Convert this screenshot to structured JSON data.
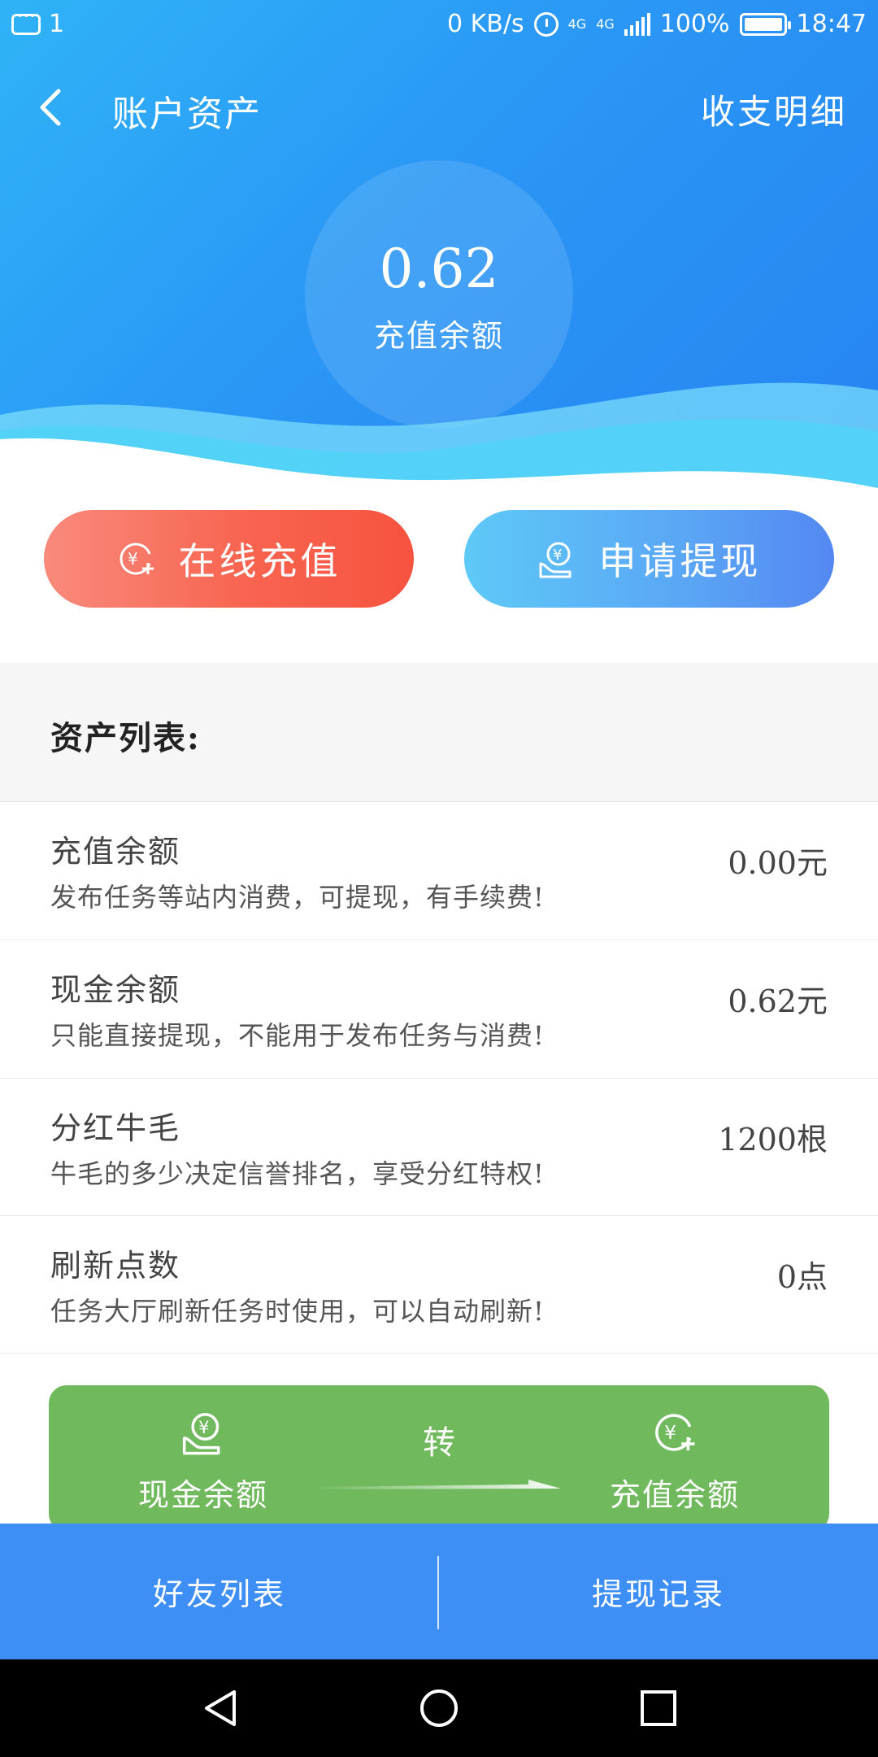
{
  "status_bar": {
    "notification_count": "1",
    "speed": "0 KB/s",
    "net_1": "4G",
    "net_2": "4G",
    "battery": "100%",
    "time": "18:47"
  },
  "nav": {
    "title": "账户资产",
    "detail_link": "收支明细"
  },
  "balance": {
    "value": "0.62",
    "label": "充值余额"
  },
  "actions": {
    "recharge_label": "在线充值",
    "withdraw_label": "申请提现"
  },
  "assets": {
    "section_title": "资产列表:",
    "items": [
      {
        "name": "充值余额",
        "desc": "发布任务等站内消费，可提现，有手续费!",
        "value": "0.00元"
      },
      {
        "name": "现金余额",
        "desc": "只能直接提现，不能用于发布任务与消费!",
        "value": "0.62元"
      },
      {
        "name": "分红牛毛",
        "desc": "牛毛的多少决定信誉排名，享受分红特权!",
        "value": "1200根"
      },
      {
        "name": "刷新点数",
        "desc": "任务大厅刷新任务时使用，可以自动刷新!",
        "value": "0点"
      }
    ]
  },
  "transfer": {
    "from_label": "现金余额",
    "middle": "转",
    "to_label": "充值余额"
  },
  "tabs": {
    "friends": "好友列表",
    "withdraw_records": "提现记录"
  },
  "colors": {
    "header_blue": "#2a97f5",
    "recharge_red": "#f6533f",
    "withdraw_blue": "#5488f2",
    "transfer_green": "#70b95d",
    "tabbar_blue": "#3d8ff6"
  },
  "icons": [
    "message-icon",
    "alarm-icon",
    "signal-icon",
    "battery-icon",
    "back-arrow-icon",
    "yuan-plus-icon",
    "yuan-hand-icon",
    "arrow-right-icon",
    "triangle-back-icon",
    "circle-home-icon",
    "square-recents-icon"
  ]
}
